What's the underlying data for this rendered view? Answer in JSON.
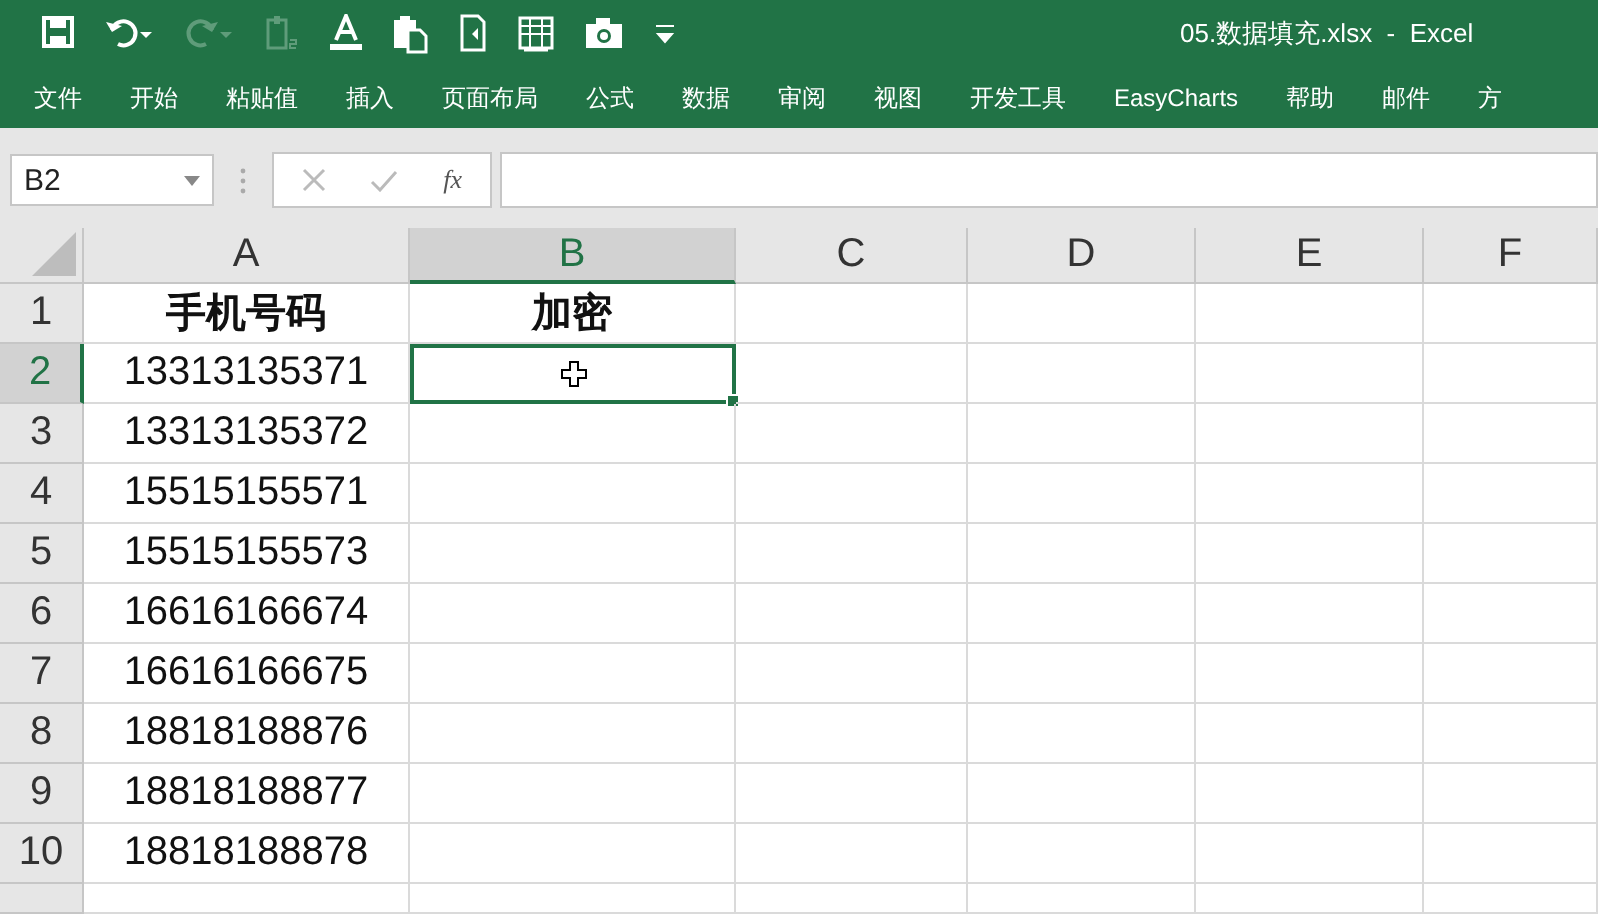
{
  "window": {
    "title": "05.数据填充.xlsx  -  Excel"
  },
  "quick_access": [
    {
      "kind": "save",
      "disabled": false
    },
    {
      "kind": "undo",
      "disabled": false
    },
    {
      "kind": "redo",
      "disabled": true
    },
    {
      "kind": "number-format",
      "disabled": true
    },
    {
      "kind": "font-color",
      "disabled": false
    },
    {
      "kind": "paste",
      "disabled": false
    },
    {
      "kind": "document",
      "disabled": false
    },
    {
      "kind": "table",
      "disabled": false
    },
    {
      "kind": "camera",
      "disabled": false
    },
    {
      "kind": "customize",
      "disabled": false
    }
  ],
  "ribbon_tabs": [
    {
      "label": "文件"
    },
    {
      "label": "开始"
    },
    {
      "label": "粘贴值"
    },
    {
      "label": "插入"
    },
    {
      "label": "页面布局"
    },
    {
      "label": "公式"
    },
    {
      "label": "数据"
    },
    {
      "label": "审阅"
    },
    {
      "label": "视图"
    },
    {
      "label": "开发工具"
    },
    {
      "label": "EasyCharts"
    },
    {
      "label": "帮助"
    },
    {
      "label": "邮件"
    },
    {
      "label": "方"
    }
  ],
  "name_box": {
    "value": "B2"
  },
  "formula_bar": {
    "function_label": "fx"
  },
  "sheet": {
    "columns": [
      {
        "label": "A",
        "selected": false
      },
      {
        "label": "B",
        "selected": true
      },
      {
        "label": "C",
        "selected": false
      },
      {
        "label": "D",
        "selected": false
      },
      {
        "label": "E",
        "selected": false
      },
      {
        "label": "F",
        "selected": false
      }
    ],
    "rows": [
      {
        "label": "1",
        "selected": false,
        "kind": "header",
        "cells": [
          {
            "text": "手机号码",
            "selected": false
          },
          {
            "text": "加密",
            "selected": false
          }
        ]
      },
      {
        "label": "2",
        "selected": true,
        "kind": "data",
        "cells": [
          {
            "text": "13313135371",
            "selected": false
          },
          {
            "selected": true
          }
        ]
      },
      {
        "label": "3",
        "selected": false,
        "kind": "data",
        "cells": [
          {
            "text": "13313135372",
            "selected": false
          },
          {
            "selected": false
          }
        ]
      },
      {
        "label": "4",
        "selected": false,
        "kind": "data",
        "cells": [
          {
            "text": "15515155571",
            "selected": false
          },
          {
            "selected": false
          }
        ]
      },
      {
        "label": "5",
        "selected": false,
        "kind": "data",
        "cells": [
          {
            "text": "15515155573",
            "selected": false
          },
          {
            "selected": false
          }
        ]
      },
      {
        "label": "6",
        "selected": false,
        "kind": "data",
        "cells": [
          {
            "text": "16616166674",
            "selected": false
          },
          {
            "selected": false
          }
        ]
      },
      {
        "label": "7",
        "selected": false,
        "kind": "data",
        "cells": [
          {
            "text": "16616166675",
            "selected": false
          },
          {
            "selected": false
          }
        ]
      },
      {
        "label": "8",
        "selected": false,
        "kind": "data",
        "cells": [
          {
            "text": "18818188876",
            "selected": false
          },
          {
            "selected": false
          }
        ]
      },
      {
        "label": "9",
        "selected": false,
        "kind": "data",
        "cells": [
          {
            "text": "18818188877",
            "selected": false
          },
          {
            "selected": false
          }
        ]
      },
      {
        "label": "10",
        "selected": false,
        "kind": "data",
        "cells": [
          {
            "text": "18818188878",
            "selected": false
          },
          {
            "selected": false
          }
        ]
      }
    ]
  }
}
